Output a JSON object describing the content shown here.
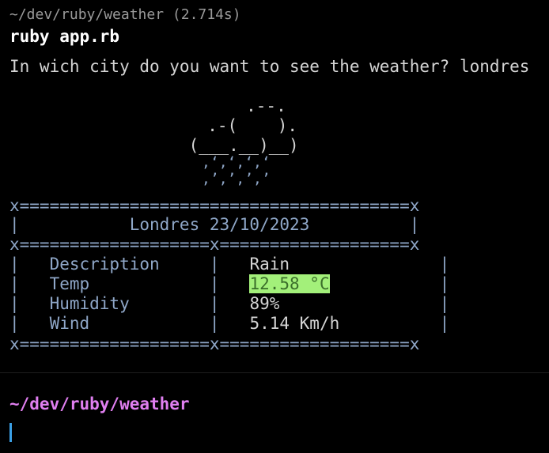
{
  "block": {
    "path_timing": "~/dev/ruby/weather (2.714s)",
    "command": "ruby app.rb",
    "output_prompt": "In wich city do you want to see the weather? londres"
  },
  "ascii_art": {
    "cloud_line_1": "        .--.",
    "cloud_line_2": "     .-(    ).",
    "cloud_line_3": "    (___.__)__)",
    "rain_line_1": "      ‚‘‚‘‚‘‚‘",
    "rain_line_2": "      ‚’‚’‚’‚’"
  },
  "table": {
    "border_top": "x=======================================x",
    "title_row": "|           Londres 23/10/2023          |",
    "border_mid": "x===================x===================x",
    "border_bottom": "x===================x===================x",
    "rows": [
      {
        "left": "|   Description     |   ",
        "value": "Rain",
        "right": "               |"
      },
      {
        "left": "|   Temp            |   ",
        "value": "12.58 °C",
        "right": "           |"
      },
      {
        "left": "|   Humidity        |   ",
        "value": "89%",
        "right": "                |"
      },
      {
        "left": "|   Wind            |   ",
        "value": "5.14 Km/h",
        "right": "          |"
      }
    ]
  },
  "next_prompt": {
    "path": "~/dev/ruby/weather"
  },
  "colors": {
    "background": "#000000",
    "prompt": "#e07ff0",
    "table_border": "#8fa7c8",
    "temp_highlight": "#a3f07a",
    "cursor": "#3ba0e6"
  }
}
